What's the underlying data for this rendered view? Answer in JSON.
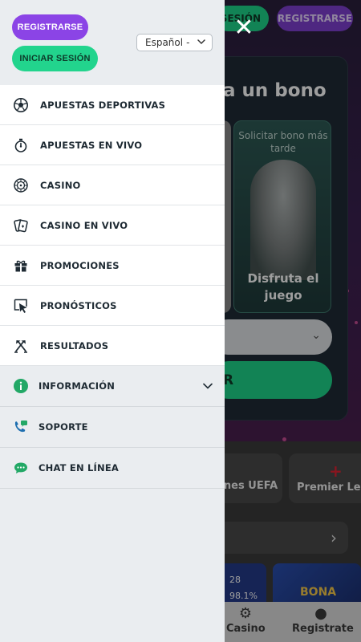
{
  "drawer": {
    "register_label": "REGISTRARSE",
    "login_label": "INICIAR SESIÓN",
    "language": "Español"
  },
  "menu": [
    {
      "label": "APUESTAS DEPORTIVAS",
      "icon": "soccer-ball-icon"
    },
    {
      "label": "APUESTAS EN VIVO",
      "icon": "stopwatch-icon"
    },
    {
      "label": "CASINO",
      "icon": "roulette-icon"
    },
    {
      "label": "CASINO EN VIVO",
      "icon": "cards-icon"
    },
    {
      "label": "PROMOCIONES",
      "icon": "gift-icon"
    },
    {
      "label": "PRONÓSTICOS",
      "icon": "cursor-icon"
    },
    {
      "label": "RESULTADOS",
      "icon": "crossed-hammers-icon"
    }
  ],
  "menu_secondary": [
    {
      "label": "INFORMACIÓN",
      "icon": "info-icon"
    },
    {
      "label": "SOPORTE",
      "icon": "phone-chat-icon"
    },
    {
      "label": "CHAT EN LÍNEA",
      "icon": "chat-bubble-icon"
    }
  ],
  "background": {
    "sesion_label": "SESIÓN",
    "register_label": "REGISTRARSE",
    "bonus_title": "a un bono",
    "offer_top": "Solicitar bono más tarde",
    "offer_bottom": "Disfruta el juego",
    "green_button_fragment": "R",
    "chip1_label": "ones UEFA",
    "chip2_label": "Premier Leag",
    "tile_value_1": "28",
    "tile_value_2": "98.1%",
    "tile2_label": "BONA",
    "nav_casino": "Casino",
    "nav_registrate": "Registrate"
  },
  "colors": {
    "drawer_bg": "#eaedf0",
    "purple": "#8b44e6",
    "green": "#22d48d",
    "info_green": "#22a866"
  }
}
